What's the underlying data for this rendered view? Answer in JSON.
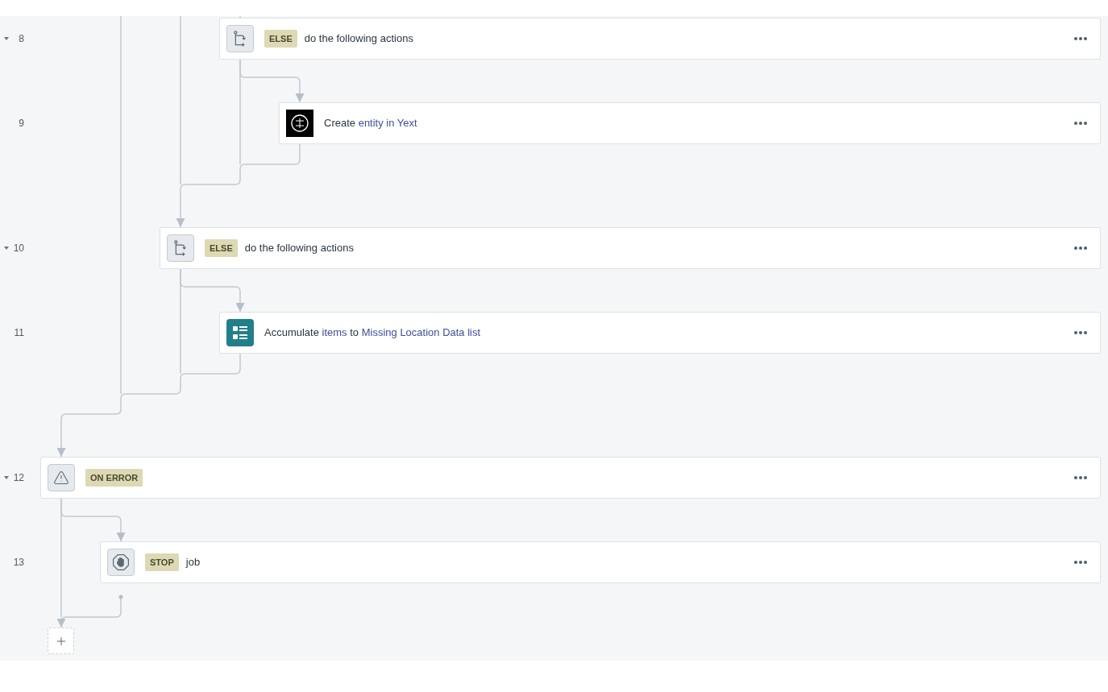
{
  "steps": [
    {
      "children": [
        {
          "children": [
            {
              "children": [
                {
                  "number": "8",
                  "expanded": true,
                  "kind": "branch",
                  "badge": "ELSE",
                  "parts": [
                    {
                      "text": "do the following actions",
                      "kind": "plain"
                    }
                  ],
                  "children": [
                    {
                      "number": "9",
                      "kind": "yext",
                      "parts": [
                        {
                          "text": "Create",
                          "kind": "plain"
                        },
                        {
                          "text": "entity in Yext",
                          "kind": "token"
                        }
                      ]
                    }
                  ]
                }
              ]
            },
            {
              "number": "10",
              "expanded": true,
              "kind": "branch",
              "badge": "ELSE",
              "parts": [
                {
                  "text": "do the following actions",
                  "kind": "plain"
                }
              ],
              "children": [
                {
                  "number": "11",
                  "kind": "list",
                  "parts": [
                    {
                      "text": "Accumulate",
                      "kind": "plain"
                    },
                    {
                      "text": "items",
                      "kind": "token"
                    },
                    {
                      "text": "to",
                      "kind": "plain"
                    },
                    {
                      "text": "Missing Location Data list",
                      "kind": "token"
                    }
                  ]
                }
              ]
            }
          ]
        }
      ]
    },
    {
      "number": "12",
      "expanded": true,
      "kind": "warning",
      "badge": "ON ERROR",
      "children": [
        {
          "number": "13",
          "kind": "stop",
          "badge": "STOP",
          "parts": [
            {
              "text": "job",
              "kind": "plain"
            }
          ]
        }
      ]
    }
  ]
}
